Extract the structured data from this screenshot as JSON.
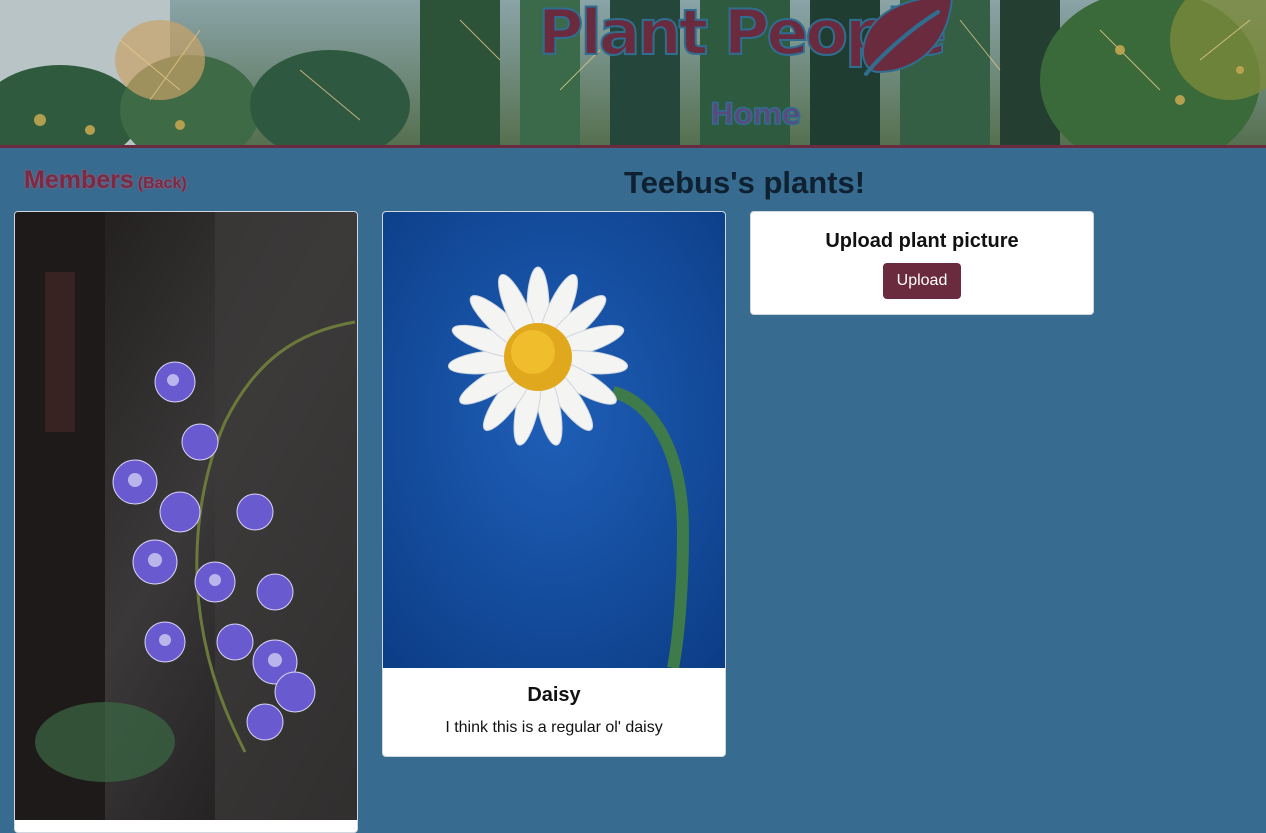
{
  "header": {
    "logo_text": "Plant People",
    "home_link": "Home"
  },
  "sidebar": {
    "title": "Members",
    "back_link": "(Back)"
  },
  "page": {
    "title": "Teebus's plants!"
  },
  "cards": [
    {
      "image": "orchid-photo"
    },
    {
      "image": "daisy-photo",
      "name": "Daisy",
      "description": "I think this is a regular ol' daisy"
    }
  ],
  "upload": {
    "title": "Upload plant picture",
    "button_label": "Upload"
  },
  "colors": {
    "page_bg": "#376b8f",
    "brand": "#6b2b3f",
    "logo_outline": "#2f6e91"
  }
}
